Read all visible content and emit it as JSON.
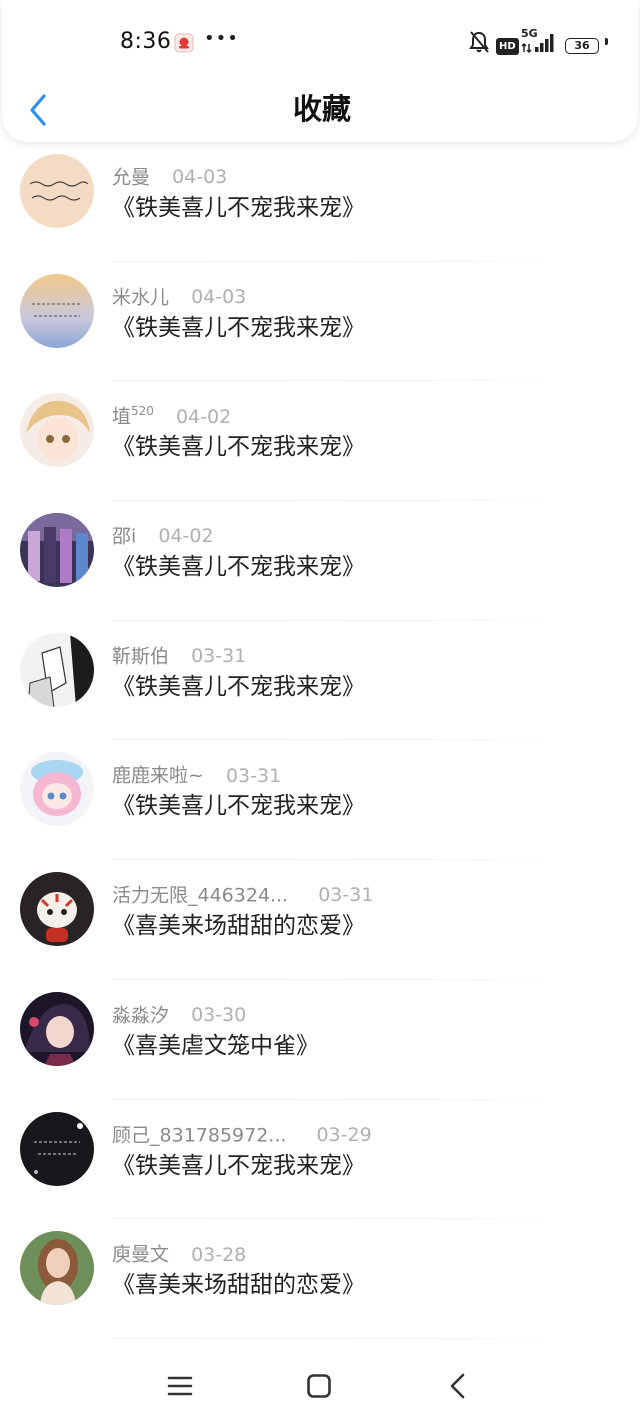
{
  "status_bar": {
    "time": "8:36",
    "notification_icon": "app-notification-icon",
    "more": "•••",
    "network": "5G",
    "hd": "HD",
    "battery": "36"
  },
  "header": {
    "title": "收藏",
    "back_icon": "chevron-left-icon"
  },
  "favorites": [
    {
      "user": "允曼",
      "sup": "",
      "date": "04-03",
      "book": "《铁美喜儿不宠我来宠》",
      "avatar": "text-note-avatar"
    },
    {
      "user": "米水儿",
      "sup": "",
      "date": "04-03",
      "book": "《铁美喜儿不宠我来宠》",
      "avatar": "sunset-text-avatar"
    },
    {
      "user": "埴",
      "sup": "520",
      "date": "04-02",
      "book": "《铁美喜儿不宠我来宠》",
      "avatar": "anime-boy-avatar"
    },
    {
      "user": "邵i",
      "sup": "",
      "date": "04-02",
      "book": "《铁美喜儿不宠我来宠》",
      "avatar": "anime-group-avatar"
    },
    {
      "user": "靳斯伯",
      "sup": "",
      "date": "03-31",
      "book": "《铁美喜儿不宠我来宠》",
      "avatar": "manga-sketch-avatar"
    },
    {
      "user": "鹿鹿来啦~",
      "sup": "",
      "date": "03-31",
      "book": "《铁美喜儿不宠我来宠》",
      "avatar": "chibi-girl-avatar"
    },
    {
      "user": "活力无限_446324...",
      "sup": "",
      "date": "03-31",
      "book": "《喜美来场甜甜的恋爱》",
      "avatar": "tiger-mascot-avatar"
    },
    {
      "user": "淼淼汐",
      "sup": "",
      "date": "03-30",
      "book": "《喜美虐文笼中雀》",
      "avatar": "dark-anime-avatar"
    },
    {
      "user": "顾己_831785972...",
      "sup": "",
      "date": "03-29",
      "book": "《铁美喜儿不宠我来宠》",
      "avatar": "night-text-avatar"
    },
    {
      "user": "庾曼文",
      "sup": "",
      "date": "03-28",
      "book": "《喜美来场甜甜的恋爱》",
      "avatar": "portrait-photo-avatar"
    }
  ],
  "nav_bar": {
    "menu": "menu-icon",
    "home": "home-icon",
    "back": "back-icon"
  }
}
